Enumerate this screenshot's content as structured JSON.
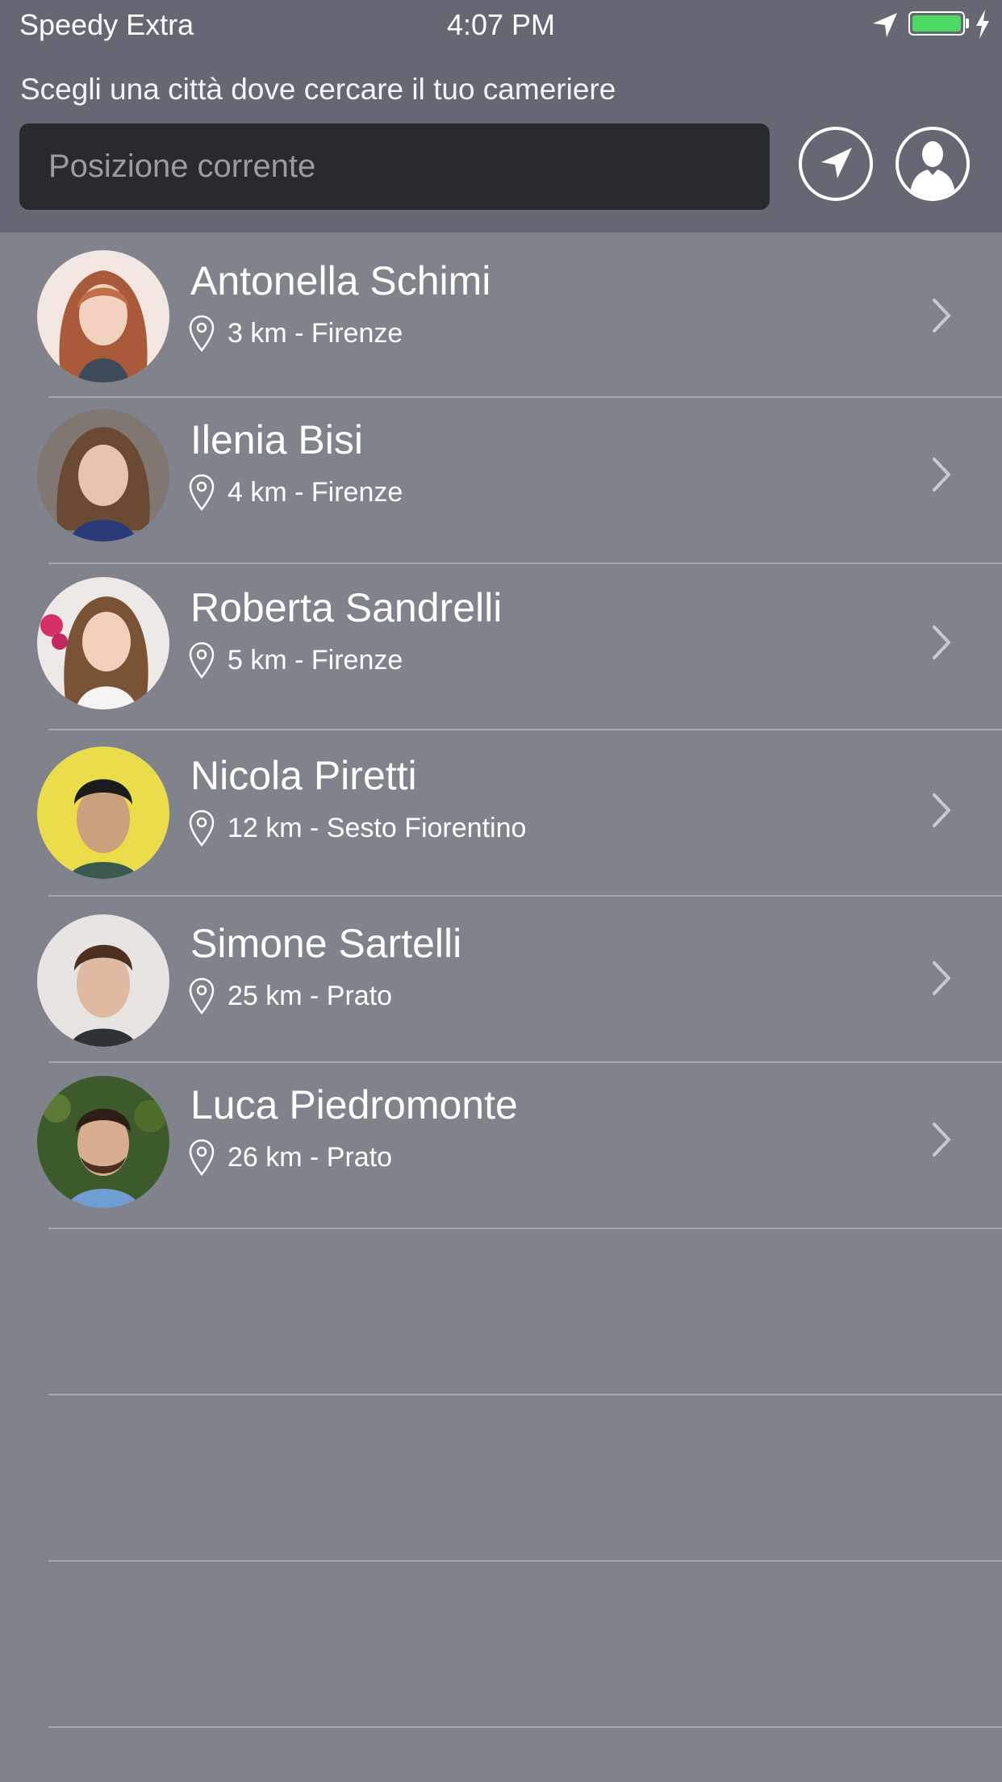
{
  "status_bar": {
    "carrier": "Speedy Extra",
    "time": "4:07 PM",
    "battery_level": 1.0,
    "battery_color": "#4cd964"
  },
  "header": {
    "subtitle": "Scegli una città dove cercare il tuo cameriere",
    "search_placeholder": "Posizione corrente",
    "search_value": "",
    "locate_icon": "location-arrow-icon",
    "profile_icon": "user-profile-icon"
  },
  "waiters": [
    {
      "name": "Antonella Schimi",
      "distance": "3 km - Firenze"
    },
    {
      "name": "Ilenia Bisi",
      "distance": "4 km - Firenze"
    },
    {
      "name": "Roberta Sandrelli",
      "distance": "5 km - Firenze"
    },
    {
      "name": "Nicola Piretti",
      "distance": "12 km - Sesto Fiorentino"
    },
    {
      "name": "Simone Sartelli",
      "distance": "25 km - Prato"
    },
    {
      "name": "Luca Piedromonte",
      "distance": "26 km - Prato"
    }
  ],
  "colors": {
    "header_bg": "#656873",
    "list_bg": "#80838c",
    "search_bg": "#292a2f"
  }
}
